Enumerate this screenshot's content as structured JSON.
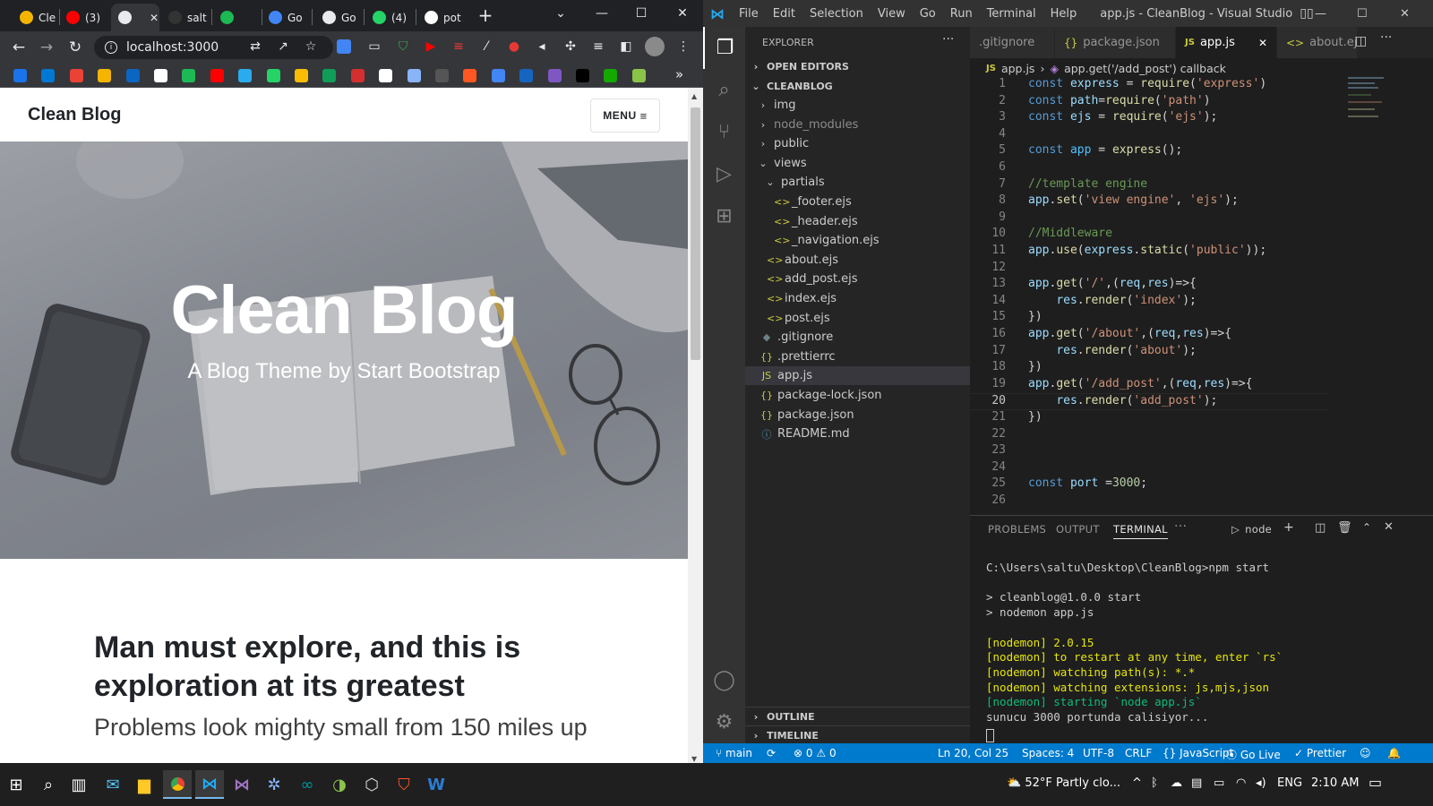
{
  "browser": {
    "tabs": [
      {
        "title": "Cle",
        "color": "#f4b400"
      },
      {
        "title": "(3)",
        "color": "#ff0000"
      },
      {
        "title": "",
        "color": "#e8eaed"
      },
      {
        "title": "salt",
        "color": "#333333"
      },
      {
        "title": "",
        "color": "#1db954"
      },
      {
        "title": "Go",
        "color": "#4285f4"
      },
      {
        "title": "Go",
        "color": "#e8eaed"
      },
      {
        "title": "(4)",
        "color": "#25d366"
      },
      {
        "title": "pot",
        "color": "#ffffff"
      }
    ],
    "url": "localhost:3000",
    "bookmark_colors": [
      "#1a73e8",
      "#0078d4",
      "#ea4335",
      "#f4b400",
      "#0a66c2",
      "#ffffff",
      "#1db954",
      "#ff0000",
      "#2aabee",
      "#25d366",
      "#fbbc04",
      "#0f9d58",
      "#d32f2f",
      "#ffffff",
      "#8ab4f8",
      "#555555",
      "#ff5722",
      "#4285f4",
      "#1565c0",
      "#7e57c2",
      "#000000",
      "#14a800",
      "#8bc34a"
    ]
  },
  "page": {
    "brand": "Clean Blog",
    "menu_label": "MENU",
    "hero_title": "Clean Blog",
    "hero_subtitle": "A Blog Theme by Start Bootstrap",
    "post_title": "Man must explore, and this is exploration at its greatest",
    "post_subtitle": "Problems look mighty small from 150 miles up"
  },
  "vscode": {
    "menus": [
      "File",
      "Edit",
      "Selection",
      "View",
      "Go",
      "Run",
      "Terminal",
      "Help"
    ],
    "window_title": "app.js - CleanBlog - Visual Studio C...",
    "explorer_title": "EXPLORER",
    "open_editors": "OPEN EDITORS",
    "project": "CLEANBLOG",
    "tree": [
      {
        "label": "img",
        "kind": "folder",
        "depth": 1
      },
      {
        "label": "node_modules",
        "kind": "folder",
        "depth": 1,
        "dim": true
      },
      {
        "label": "public",
        "kind": "folder",
        "depth": 1
      },
      {
        "label": "views",
        "kind": "folder-open",
        "depth": 1
      },
      {
        "label": "partials",
        "kind": "folder-open",
        "depth": 2
      },
      {
        "label": "_footer.ejs",
        "kind": "ejs",
        "depth": 3
      },
      {
        "label": "_header.ejs",
        "kind": "ejs",
        "depth": 3
      },
      {
        "label": "_navigation.ejs",
        "kind": "ejs",
        "depth": 3
      },
      {
        "label": "about.ejs",
        "kind": "ejs",
        "depth": 2
      },
      {
        "label": "add_post.ejs",
        "kind": "ejs",
        "depth": 2
      },
      {
        "label": "index.ejs",
        "kind": "ejs",
        "depth": 2
      },
      {
        "label": "post.ejs",
        "kind": "ejs",
        "depth": 2
      },
      {
        "label": ".gitignore",
        "kind": "git",
        "depth": 1
      },
      {
        "label": ".prettierrc",
        "kind": "json",
        "depth": 1
      },
      {
        "label": "app.js",
        "kind": "js",
        "depth": 1,
        "selected": true
      },
      {
        "label": "package-lock.json",
        "kind": "json",
        "depth": 1
      },
      {
        "label": "package.json",
        "kind": "json",
        "depth": 1
      },
      {
        "label": "README.md",
        "kind": "info",
        "depth": 1
      }
    ],
    "outline": "OUTLINE",
    "timeline": "TIMELINE",
    "editor_tabs": [
      {
        "label": ".gitignore",
        "icon": "",
        "active": false
      },
      {
        "label": "package.json",
        "icon": "{}",
        "active": false
      },
      {
        "label": "app.js",
        "icon": "JS",
        "active": true
      },
      {
        "label": "about.ejs",
        "icon": "<>",
        "active": false
      }
    ],
    "breadcrumb": [
      "app.js",
      "app.get('/add_post') callback"
    ],
    "code": [
      "const express = require('express')",
      "const path=require('path')",
      "const ejs = require('ejs');",
      "",
      "const app = express();",
      "",
      "//template engine",
      "app.set('view engine', 'ejs');",
      "",
      "//Middleware",
      "app.use(express.static('public'));",
      "",
      "app.get('/',(req,res)=>{",
      "    res.render('index');",
      "})",
      "app.get('/about',(req,res)=>{",
      "    res.render('about');",
      "})",
      "app.get('/add_post',(req,res)=>{",
      "    res.render('add_post');",
      "})",
      "",
      "",
      "",
      "const port =3000;",
      ""
    ],
    "current_line": 20,
    "panel_tabs": [
      "PROBLEMS",
      "OUTPUT",
      "TERMINAL"
    ],
    "terminal_name": "node",
    "terminal": [
      {
        "text": "C:\\Users\\saltu\\Desktop\\CleanBlog>npm start",
        "color": "#cccccc"
      },
      {
        "text": "",
        "color": "#cccccc"
      },
      {
        "text": "> cleanblog@1.0.0 start",
        "color": "#cccccc"
      },
      {
        "text": "> nodemon app.js",
        "color": "#cccccc"
      },
      {
        "text": "",
        "color": "#cccccc"
      },
      {
        "text": "[nodemon] 2.0.15",
        "color": "#e5e510"
      },
      {
        "text": "[nodemon] to restart at any time, enter `rs`",
        "color": "#e5e510"
      },
      {
        "text": "[nodemon] watching path(s): *.*",
        "color": "#e5e510"
      },
      {
        "text": "[nodemon] watching extensions: js,mjs,json",
        "color": "#e5e510"
      },
      {
        "text": "[nodemon] starting `node app.js`",
        "color": "#0dbc79"
      },
      {
        "text": "sunucu 3000 portunda calisiyor...",
        "color": "#cccccc"
      }
    ],
    "status": {
      "branch": "main",
      "problems": "0",
      "warnings": "0",
      "position": "Ln 20, Col 25",
      "spaces": "Spaces: 4",
      "encoding": "UTF-8",
      "eol": "CRLF",
      "language": "JavaScript",
      "golive": "Go Live",
      "prettier": "Prettier"
    }
  },
  "taskbar": {
    "weather": "52°F  Partly clo...",
    "lang": "ENG",
    "time": "2:10 AM"
  }
}
